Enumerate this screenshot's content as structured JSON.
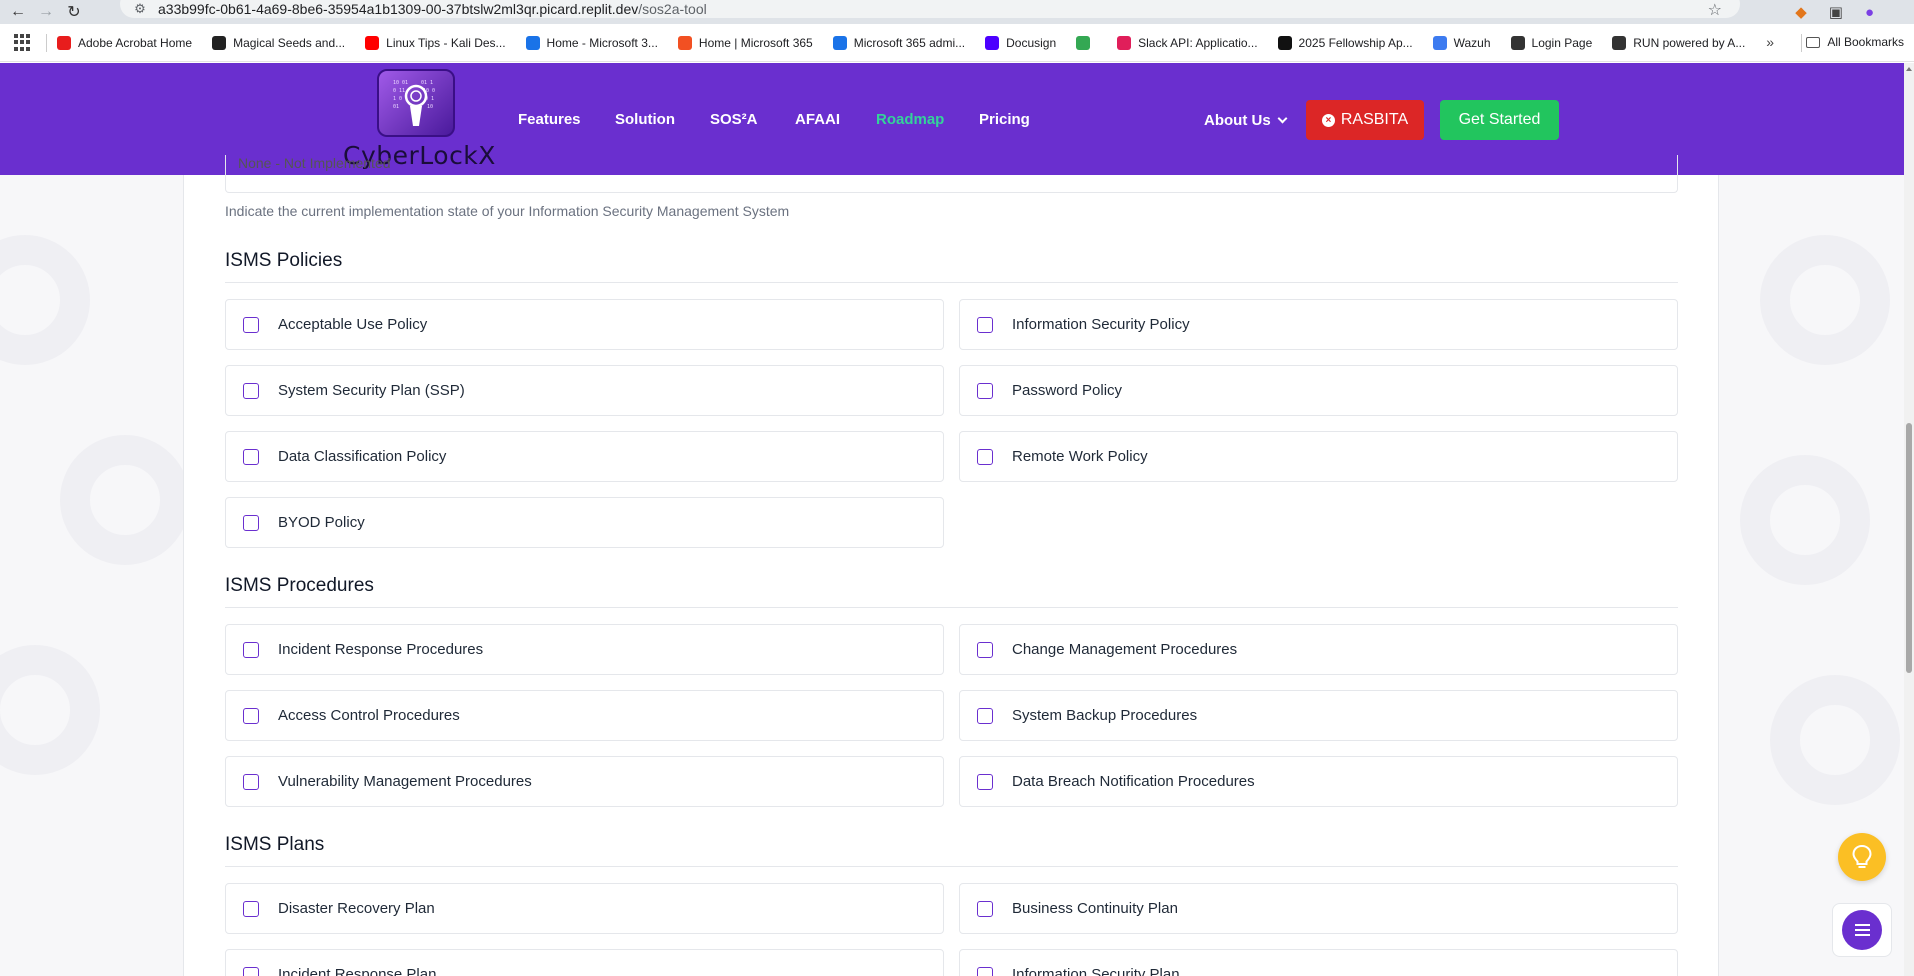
{
  "browser": {
    "url_host": "a33b99fc-0b61-4a69-8be6-35954a1b1309-00-37btslw2ml3qr.picard.replit.dev",
    "url_path": "/sos2a-tool",
    "bookmarks": [
      {
        "label": "Adobe Acrobat Home",
        "color": "#e81d1d"
      },
      {
        "label": "Magical Seeds and...",
        "color": "#222222"
      },
      {
        "label": "Linux Tips - Kali Des...",
        "color": "#ff0000"
      },
      {
        "label": "Home - Microsoft 3...",
        "color": "#1a73e8"
      },
      {
        "label": "Home | Microsoft 365",
        "color": "#f25022"
      },
      {
        "label": "Microsoft 365 admi...",
        "color": "#1a73e8"
      },
      {
        "label": "Docusign",
        "color": "#4c00ff"
      },
      {
        "label": "",
        "color": "#34a853"
      },
      {
        "label": "Slack API: Applicatio...",
        "color": "#e01e5a"
      },
      {
        "label": "2025 Fellowship Ap...",
        "color": "#111111"
      },
      {
        "label": "Wazuh",
        "color": "#3d7bf0"
      },
      {
        "label": "Login Page",
        "color": "#333333"
      },
      {
        "label": "RUN powered by A...",
        "color": "#333333"
      }
    ],
    "all_bookmarks": "All Bookmarks"
  },
  "header": {
    "logo_text": "CyberLockX",
    "nav": [
      "Features",
      "Solution",
      "SOS²A",
      "AFAAI",
      "Roadmap",
      "Pricing"
    ],
    "active_nav": "Roadmap",
    "about": "About Us",
    "rasbita": "RASBITA",
    "get_started": "Get Started"
  },
  "form": {
    "previous_select_value": "None - Not Implemented",
    "help_text": "Indicate the current implementation state of your Information Security Management System",
    "sections": [
      {
        "title": "ISMS Policies",
        "options": [
          "Acceptable Use Policy",
          "Information Security Policy",
          "System Security Plan (SSP)",
          "Password Policy",
          "Data Classification Policy",
          "Remote Work Policy",
          "BYOD Policy"
        ]
      },
      {
        "title": "ISMS Procedures",
        "options": [
          "Incident Response Procedures",
          "Change Management Procedures",
          "Access Control Procedures",
          "System Backup Procedures",
          "Vulnerability Management Procedures",
          "Data Breach Notification Procedures"
        ]
      },
      {
        "title": "ISMS Plans",
        "options": [
          "Disaster Recovery Plan",
          "Business Continuity Plan",
          "Incident Response Plan",
          "Information Security Plan"
        ]
      }
    ]
  },
  "colors": {
    "brand": "#6a2fcf",
    "active_nav": "#34d399",
    "rasbita": "#dc2626",
    "get_started": "#22c55e",
    "tip_fab": "#fbbf24"
  }
}
